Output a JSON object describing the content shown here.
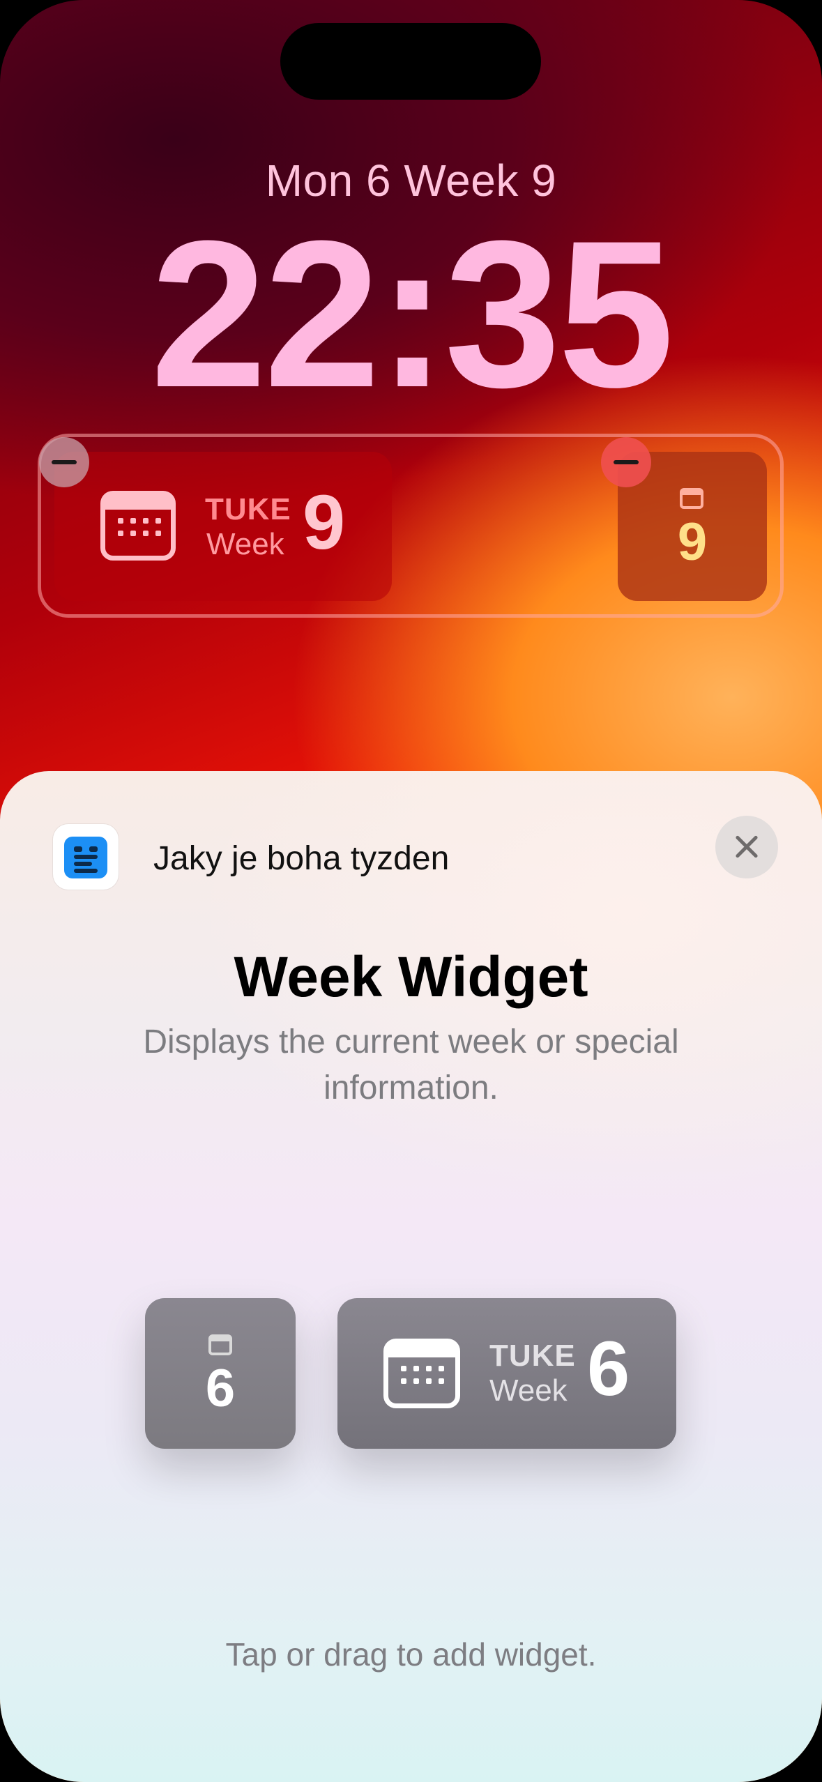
{
  "lock_screen": {
    "date_line": "Mon 6  Week 9",
    "time": "22:35",
    "widgets": {
      "wide": {
        "title": "TUKE",
        "subtitle": "Week",
        "value": "9"
      },
      "small": {
        "value": "9"
      }
    }
  },
  "sheet": {
    "app_name": "Jaky je boha tyzden",
    "widget_title": "Week Widget",
    "description": "Displays the current week or special information.",
    "preview_small": {
      "value": "6"
    },
    "preview_wide": {
      "title": "TUKE",
      "subtitle": "Week",
      "value": "6"
    },
    "hint": "Tap or drag to add widget."
  },
  "icons": {
    "remove": "minus-circle-icon",
    "close": "close-icon",
    "calendar": "calendar-icon",
    "app": "app-icon"
  },
  "colors": {
    "time": "#ffb8e0",
    "accent_yellow": "#ffe08a",
    "sheet_text": "#111111",
    "secondary_text": "#7c7c80"
  }
}
